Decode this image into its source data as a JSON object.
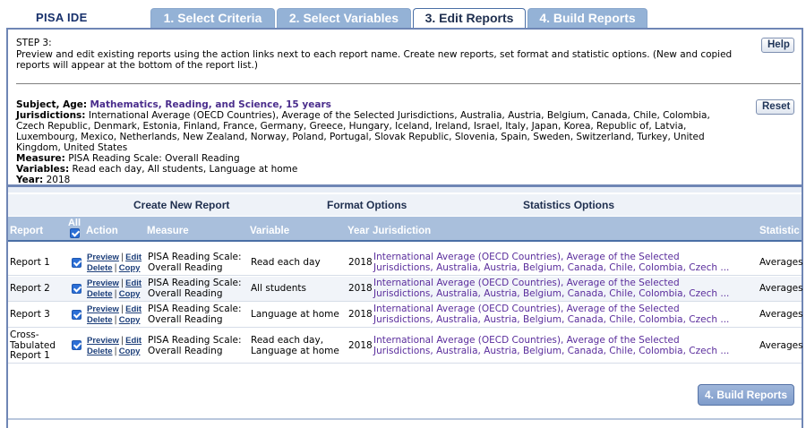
{
  "app": {
    "logo": "PISA IDE"
  },
  "tabs": [
    {
      "label": "1. Select Criteria",
      "active": false
    },
    {
      "label": "2. Select Variables",
      "active": false
    },
    {
      "label": "3. Edit Reports",
      "active": true
    },
    {
      "label": "4. Build Reports",
      "active": false
    }
  ],
  "step": {
    "title": "STEP 3:",
    "text": "Preview and edit existing reports using the action links next to each report name. Create new reports, set format and statistic options. (New and copied reports will appear at the bottom of the report list.)",
    "help_label": "Help",
    "reset_label": "Reset"
  },
  "criteria": {
    "subject_label": "Subject, Age:",
    "subject_value": "Mathematics, Reading, and Science, 15 years",
    "jurisdictions_label": "Jurisdictions:",
    "jurisdictions_value": "International Average (OECD Countries), Average of the Selected Jurisdictions, Australia, Austria, Belgium, Canada, Chile, Colombia, Czech Republic, Denmark, Estonia, Finland, France, Germany, Greece, Hungary, Iceland, Ireland, Israel, Italy, Japan, Korea, Republic of, Latvia, Luxembourg, Mexico, Netherlands, New Zealand, Norway, Poland, Portugal, Slovak Republic, Slovenia, Spain, Sweden, Switzerland, Turkey, United Kingdom, United States",
    "measure_label": "Measure:",
    "measure_value": "PISA Reading Scale: Overall Reading",
    "variables_label": "Variables:",
    "variables_value": "Read each day, All students, Language at home",
    "year_label": "Year:",
    "year_value": "2018"
  },
  "options": {
    "create_new": "Create New Report",
    "format": "Format Options",
    "statistics": "Statistics Options"
  },
  "table": {
    "headers": {
      "report": "Report",
      "all": "All",
      "action": "Action",
      "measure": "Measure",
      "variable": "Variable",
      "year": "Year",
      "jurisdiction": "Jurisdiction",
      "statistic": "Statistic"
    },
    "actions": {
      "preview": "Preview",
      "edit": "Edit",
      "delete": "Delete",
      "copy": "Copy"
    },
    "rows": [
      {
        "report": "Report 1",
        "checked": true,
        "measure": "PISA Reading Scale: Overall Reading",
        "variable": "Read each day",
        "year": "2018",
        "jurisdiction": "International Average (OECD Countries), Average of the Selected Jurisdictions, Australia, Austria, Belgium, Canada, Chile, Colombia, Czech ...",
        "statistic": "Averages"
      },
      {
        "report": "Report 2",
        "checked": true,
        "measure": "PISA Reading Scale: Overall Reading",
        "variable": "All students",
        "year": "2018",
        "jurisdiction": "International Average (OECD Countries), Average of the Selected Jurisdictions, Australia, Austria, Belgium, Canada, Chile, Colombia, Czech ...",
        "statistic": "Averages"
      },
      {
        "report": "Report 3",
        "checked": true,
        "measure": "PISA Reading Scale: Overall Reading",
        "variable": "Language at home",
        "year": "2018",
        "jurisdiction": "International Average (OECD Countries), Average of the Selected Jurisdictions, Australia, Austria, Belgium, Canada, Chile, Colombia, Czech ...",
        "statistic": "Averages"
      },
      {
        "report": "Cross-Tabulated Report 1",
        "checked": true,
        "measure": "PISA Reading Scale: Overall Reading",
        "variable": "Read each day, Language at home",
        "year": "2018",
        "jurisdiction": "International Average (OECD Countries), Average of the Selected Jurisdictions, Australia, Austria, Belgium, Canada, Chile, Colombia, Czech ...",
        "statistic": "Averages"
      }
    ]
  },
  "build_button_label": "4. Build Reports",
  "colors": {
    "tab_inactive": "#94b2d6",
    "frame_border": "#6f86b5",
    "header_bg": "#a9bfdc",
    "link_purple": "#5a2d9c",
    "checkbox": "#2b6fd6"
  }
}
